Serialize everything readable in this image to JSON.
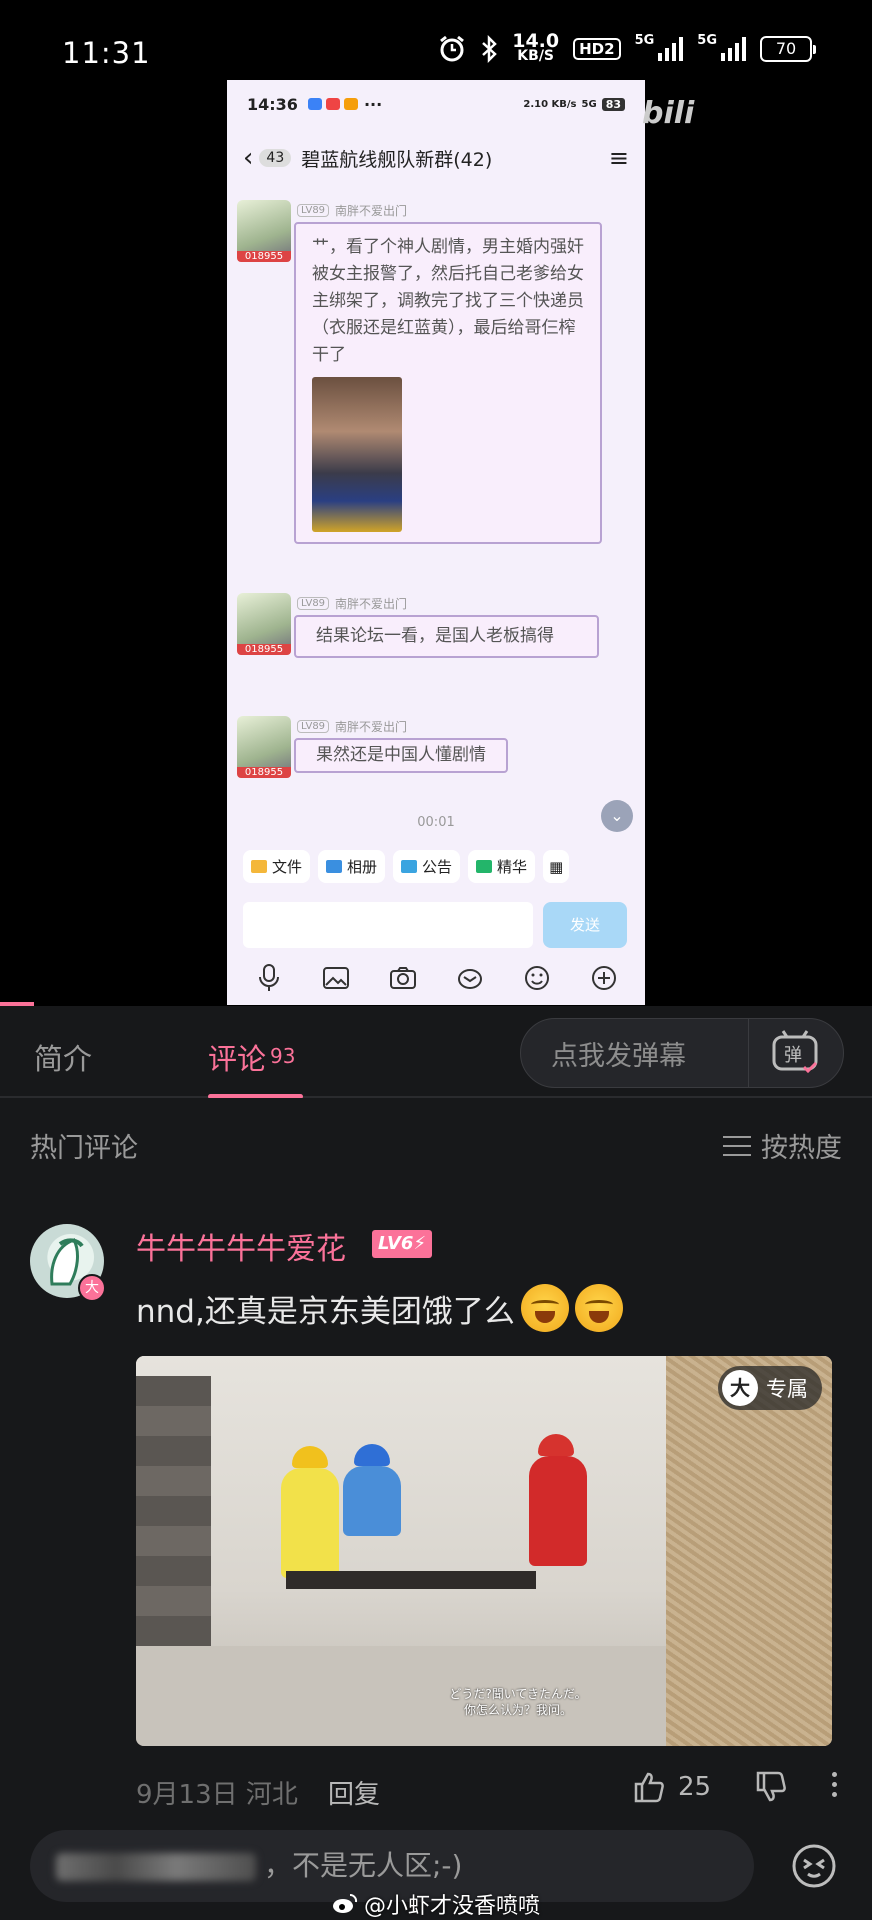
{
  "status_bar": {
    "time": "11:31",
    "speed_value": "14.0",
    "speed_unit": "KB/S",
    "hd_label": "HD2",
    "net1": "5G",
    "net2": "5G",
    "battery": "70",
    "icons": [
      "alarm-icon",
      "bluetooth-icon",
      "signal-icon",
      "battery-icon"
    ]
  },
  "video": {
    "watermark_logo": "bili",
    "phone": {
      "time": "14:36",
      "status_right": "2.10 KB/s",
      "net": "5G",
      "battery": "83",
      "unread_count": "43",
      "group_title": "碧蓝航线舰队新群(42)",
      "messages": [
        {
          "level": "LV89",
          "sender": "南胖不爱出门",
          "avatar_tag": "018955",
          "text": "艹，看了个神人剧情，男主婚内强奸被女主报警了，然后托自己老爹给女主绑架了，调教完了找了三个快递员（衣服还是红蓝黄），最后给哥仨榨干了"
        },
        {
          "level": "LV89",
          "sender": "南胖不爱出门",
          "avatar_tag": "018955",
          "text": "结果论坛一看，是国人老板搞得"
        },
        {
          "level": "LV89",
          "sender": "南胖不爱出门",
          "avatar_tag": "018955",
          "text": "果然还是中国人懂剧情"
        }
      ],
      "timestamp": "00:01",
      "tools": [
        {
          "label": "文件",
          "color": "#f4b73a"
        },
        {
          "label": "相册",
          "color": "#3a8fe0"
        },
        {
          "label": "公告",
          "color": "#3aa4e0"
        },
        {
          "label": "精华",
          "color": "#23b56a"
        }
      ],
      "send_label": "发送"
    }
  },
  "tabs": {
    "intro": "简介",
    "comments": "评论",
    "comments_count": "93",
    "danmu_placeholder": "点我发弹幕",
    "danmu_icon_label": "弹"
  },
  "comments_section": {
    "hot_label": "热门评论",
    "sort_label": "按热度",
    "comment": {
      "username": "牛牛牛牛牛爱花",
      "level": "LV6",
      "avatar_badge": "大",
      "text": "nnd,还真是京东美团饿了么",
      "image_badge_icon": "大",
      "image_badge": "专属",
      "subtitle_jp": "どうだ?聞いてきたんだ。",
      "subtitle_cn": "你怎么认为？我问。",
      "date": "9月13日",
      "location": "河北",
      "reply_label": "回复",
      "likes": "25",
      "helmet_colors": [
        "#f1c11d",
        "#2f6fd6",
        "#d6332e"
      ],
      "shirt_colors": [
        "#f2e14a",
        "#4a8ed8",
        "#d22a2a"
      ]
    }
  },
  "bottom_bar": {
    "input_tail": "，不是无人区;-)",
    "watermark": "@小虾才没香喷喷"
  },
  "colors": {
    "accent": "#fb7299",
    "background": "#17181a"
  }
}
